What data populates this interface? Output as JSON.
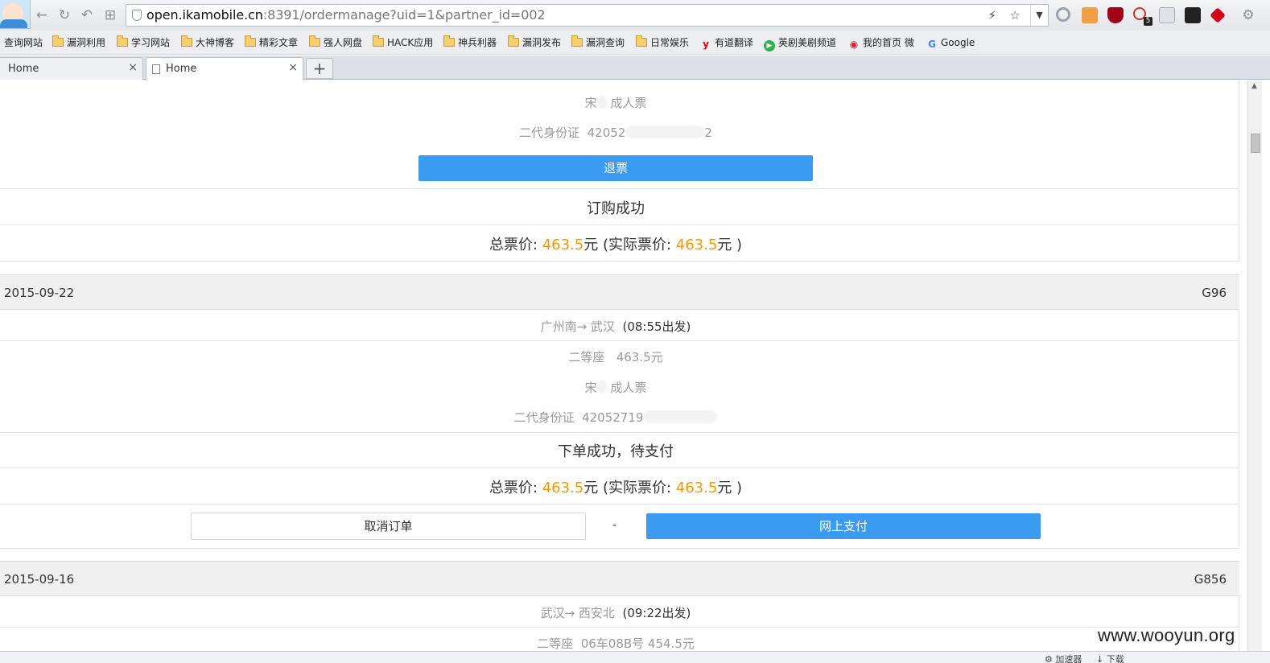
{
  "browser": {
    "url_host": "open.ikamobile.cn",
    "url_rest": ":8391/ordermanage?uid=1&partner_id=002",
    "bookmarks": [
      {
        "label": "查询网站",
        "type": "plain"
      },
      {
        "label": "漏洞利用",
        "type": "folder"
      },
      {
        "label": "学习网站",
        "type": "folder"
      },
      {
        "label": "大神博客",
        "type": "folder"
      },
      {
        "label": "精彩文章",
        "type": "folder"
      },
      {
        "label": "强人网盘",
        "type": "folder"
      },
      {
        "label": "HACK应用",
        "type": "folder"
      },
      {
        "label": "神兵利器",
        "type": "folder"
      },
      {
        "label": "漏洞发布",
        "type": "folder"
      },
      {
        "label": "漏洞查询",
        "type": "folder"
      },
      {
        "label": "日常娱乐",
        "type": "folder"
      },
      {
        "label": "有道翻译",
        "type": "youdao"
      },
      {
        "label": "英剧美剧频道",
        "type": "play"
      },
      {
        "label": "我的首页 微",
        "type": "weibo"
      },
      {
        "label": "Google",
        "type": "google"
      }
    ],
    "tabs": [
      {
        "title": "Home",
        "close": "×"
      },
      {
        "title": "Home",
        "close": "×"
      }
    ],
    "new_tab": "+",
    "badge": "5"
  },
  "order1": {
    "passenger": "宋",
    "passenger_suffix": "成人票",
    "id_label": "二代身份证",
    "id_prefix": "42052",
    "id_suffix": "2",
    "refund_button": "退票",
    "status": "订购成功",
    "total_label": "总票价: ",
    "total": "463.5",
    "yuan": "元",
    "actual_label": " (实际票价: ",
    "actual": "463.5",
    "actual_close": "元 )"
  },
  "order2": {
    "date": "2015-09-22",
    "train": "G96",
    "route": "广州南→ 武汉",
    "depart": "(08:55出发)",
    "seat": "二等座",
    "seat_price": "463.5元",
    "passenger": "宋",
    "passenger_suffix": "成人票",
    "id_label": "二代身份证",
    "id_prefix": "42052719",
    "status": "下单成功，待支付",
    "total_label": "总票价: ",
    "total": "463.5",
    "yuan": "元",
    "actual_label": " (实际票价: ",
    "actual": "463.5",
    "actual_close": "元 )",
    "cancel_button": "取消订单",
    "separator": "-",
    "pay_button": "网上支付"
  },
  "order3": {
    "date": "2015-09-16",
    "train": "G856",
    "route": "武汉→ 西安北",
    "depart": "(09:22出发)",
    "seat": "二等座",
    "seat_detail": "06车08B号 454.5元"
  },
  "statusbar": {
    "accelerator": "加速器",
    "download": "下载"
  },
  "watermark": "www.wooyun.org",
  "colors": {
    "accent_blue": "#3a9bf0",
    "price_orange": "#f39800"
  }
}
